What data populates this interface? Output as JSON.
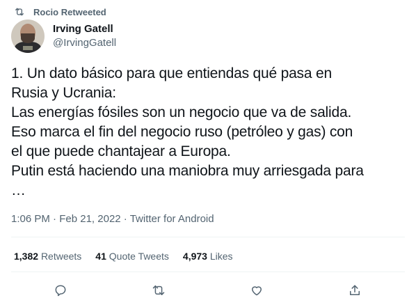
{
  "retweet_banner": {
    "text": "Rocio Retweeted",
    "icon": "retweet-icon"
  },
  "author": {
    "display_name": "Irving Gatell",
    "handle": "@IrvingGatell"
  },
  "tweet": {
    "text": "1. Un dato básico para que entiendas qué pasa en\nRusia y Ucrania:\nLas energías fósiles son un negocio que va de salida.\nEso marca el fin del negocio ruso (petróleo y gas) con\nel que puede chantajear a Europa.\nPutin está haciendo una maniobra muy arriesgada para\n…"
  },
  "meta": {
    "time": "1:06 PM",
    "date": "Feb 21, 2022",
    "source": "Twitter for Android"
  },
  "stats": {
    "retweets": {
      "count": "1,382",
      "label": "Retweets"
    },
    "quote_tweets": {
      "count": "41",
      "label": "Quote Tweets"
    },
    "likes": {
      "count": "4,973",
      "label": "Likes"
    }
  },
  "actions": [
    "reply-icon",
    "retweet-icon",
    "like-icon",
    "share-icon"
  ],
  "colors": {
    "text": "#0f1419",
    "secondary": "#536471",
    "divider": "#eff3f4"
  }
}
